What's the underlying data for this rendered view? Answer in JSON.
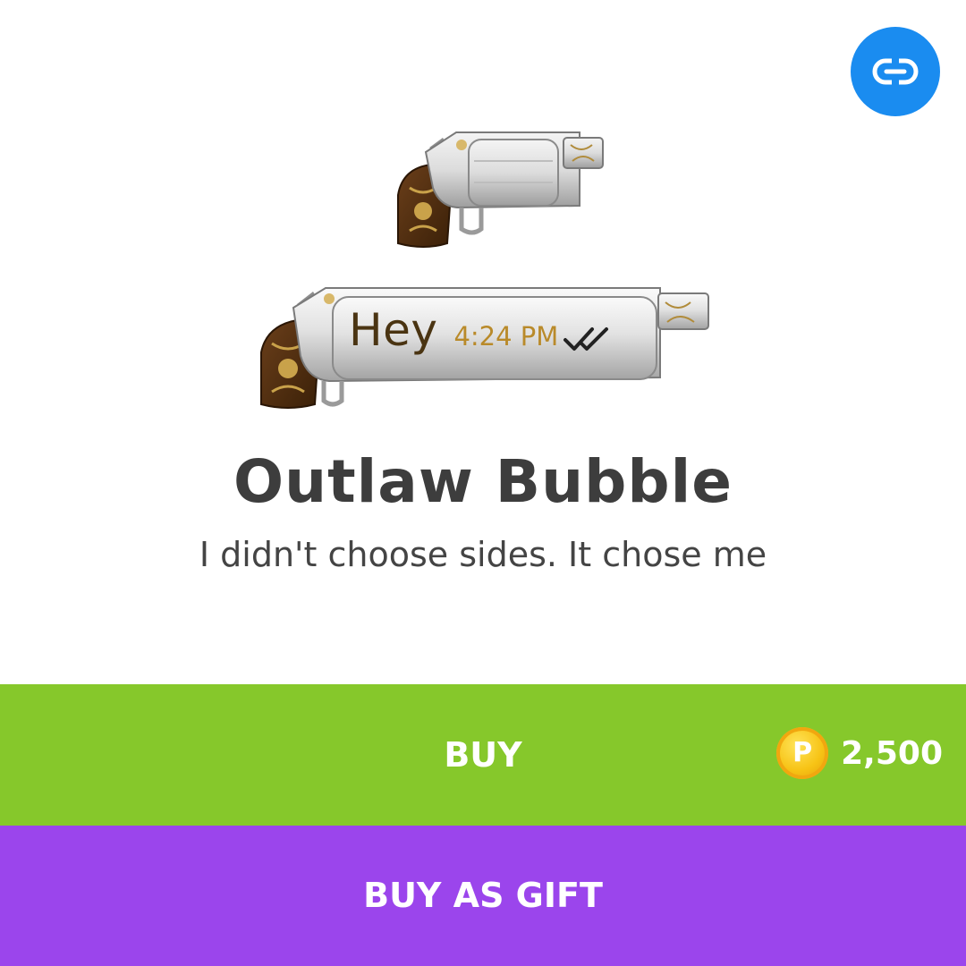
{
  "header": {
    "link_icon": "link-icon"
  },
  "preview": {
    "small_icon": "revolver-icon",
    "bubble_icon": "revolver-bubble",
    "message_text": "Hey",
    "message_time": "4:24 PM",
    "read_status_icon": "double-check-icon"
  },
  "product": {
    "title": "Outlaw Bubble",
    "description": "I didn't choose sides. It chose me"
  },
  "actions": {
    "buy_label": "BUY",
    "price": "2,500",
    "currency_symbol": "P",
    "currency_icon": "coin-icon",
    "gift_label": "BUY AS GIFT"
  },
  "colors": {
    "link_button": "#1a8cf0",
    "buy_bar": "#86c82b",
    "gift_bar": "#9b45ec",
    "title_text": "#3d3d3d",
    "bubble_text": "#4a3412",
    "bubble_time": "#b98a2a"
  }
}
